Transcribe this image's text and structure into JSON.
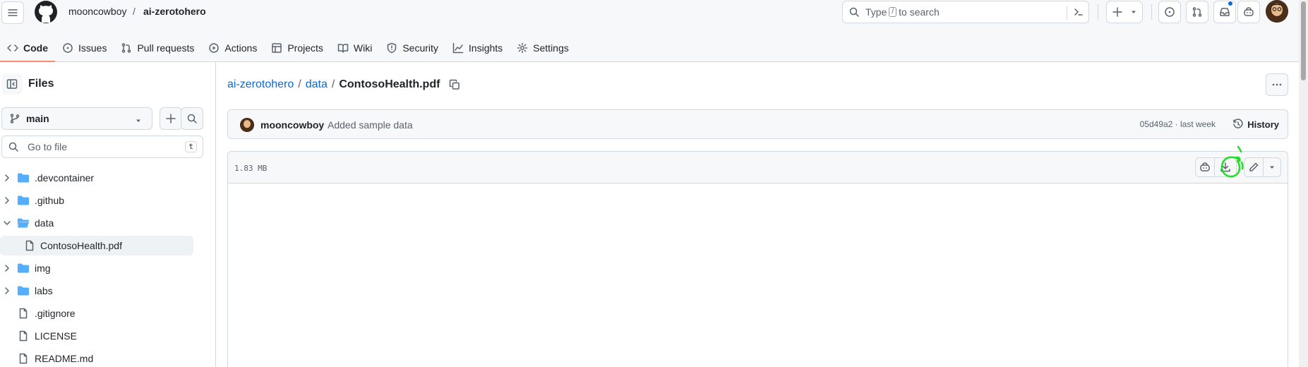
{
  "header": {
    "owner": "mooncowboy",
    "separator": "/",
    "repo": "ai-zerotohero",
    "search": {
      "prefix": "Type",
      "key": "/",
      "suffix": "to search"
    }
  },
  "nav": {
    "tabs": [
      {
        "label": "Code",
        "icon": "code-icon",
        "active": true
      },
      {
        "label": "Issues",
        "icon": "issue-opened-icon"
      },
      {
        "label": "Pull requests",
        "icon": "git-pull-request-icon"
      },
      {
        "label": "Actions",
        "icon": "play-icon"
      },
      {
        "label": "Projects",
        "icon": "table-icon"
      },
      {
        "label": "Wiki",
        "icon": "book-icon"
      },
      {
        "label": "Security",
        "icon": "shield-icon"
      },
      {
        "label": "Insights",
        "icon": "graph-icon"
      },
      {
        "label": "Settings",
        "icon": "gear-icon"
      }
    ]
  },
  "sidebar": {
    "title": "Files",
    "branch": "main",
    "go_to_file": {
      "placeholder": "Go to file",
      "shortcut": "t"
    },
    "tree": [
      {
        "label": ".devcontainer",
        "type": "folder",
        "expanded": false
      },
      {
        "label": ".github",
        "type": "folder",
        "expanded": false
      },
      {
        "label": "data",
        "type": "folder",
        "expanded": true
      },
      {
        "label": "ContosoHealth.pdf",
        "type": "file",
        "selected": true
      },
      {
        "label": "img",
        "type": "folder",
        "expanded": false
      },
      {
        "label": "labs",
        "type": "folder",
        "expanded": false
      },
      {
        "label": ".gitignore",
        "type": "file"
      },
      {
        "label": "LICENSE",
        "type": "file"
      },
      {
        "label": "README.md",
        "type": "file"
      }
    ]
  },
  "main": {
    "path": {
      "root": "ai-zerotohero",
      "folder": "data",
      "file": "ContosoHealth.pdf",
      "sep": "/"
    },
    "commit": {
      "author": "mooncowboy",
      "message": "Added sample data",
      "sha_time": "05d49a2 · last week",
      "history_label": "History"
    },
    "file": {
      "size": "1.83 MB"
    }
  },
  "colors": {
    "accent_link": "#0969da",
    "active_tab_underline": "#fd8c73",
    "annotation_circle": "#22dd22"
  }
}
